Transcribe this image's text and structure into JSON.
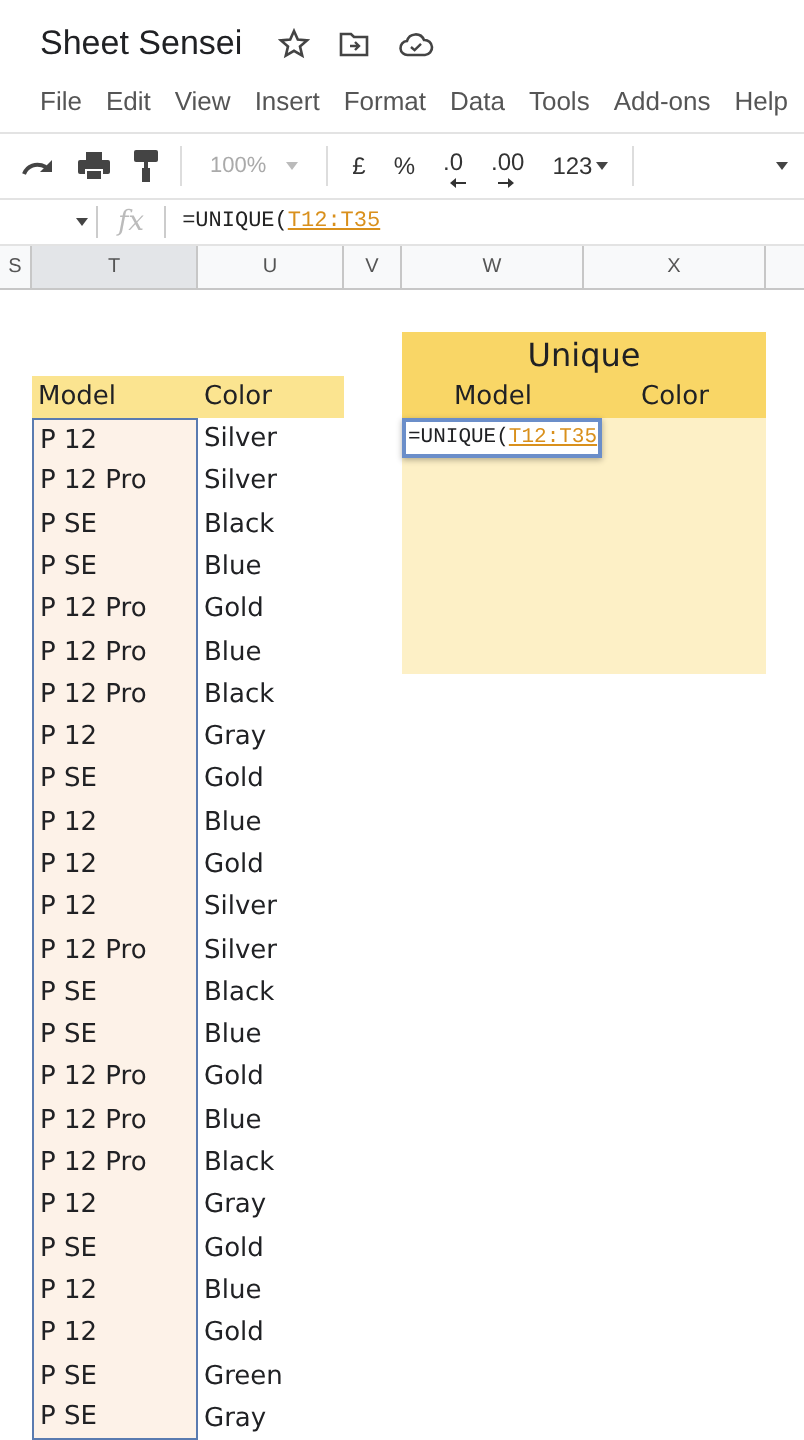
{
  "app": {
    "title": "Sheet Sensei"
  },
  "menu": [
    "File",
    "Edit",
    "View",
    "Insert",
    "Format",
    "Data",
    "Tools",
    "Add-ons",
    "Help"
  ],
  "toolbar": {
    "zoom": "100%",
    "currency": "£",
    "percent": "%",
    "decrease_decimal": ".0",
    "increase_decimal": ".00",
    "number_format": "123"
  },
  "formula_bar": {
    "fx": "fx",
    "formula": "=UNIQUE(",
    "range": "T12:T35"
  },
  "columns": [
    {
      "label": "S",
      "selected": false
    },
    {
      "label": "T",
      "selected": true
    },
    {
      "label": "U",
      "selected": false
    },
    {
      "label": "V",
      "selected": false
    },
    {
      "label": "W",
      "selected": false
    },
    {
      "label": "X",
      "selected": false
    }
  ],
  "source": {
    "headers": [
      "Model",
      "Color"
    ],
    "rows": [
      [
        "P 12",
        "Silver"
      ],
      [
        "P 12 Pro",
        "Silver"
      ],
      [
        "P SE",
        "Black"
      ],
      [
        "P SE",
        "Blue"
      ],
      [
        "P 12 Pro",
        "Gold"
      ],
      [
        "P 12 Pro",
        "Blue"
      ],
      [
        "P 12 Pro",
        "Black"
      ],
      [
        "P 12",
        "Gray"
      ],
      [
        "P SE",
        "Gold"
      ],
      [
        "P 12",
        "Blue"
      ],
      [
        "P 12",
        "Gold"
      ],
      [
        "P 12",
        "Silver"
      ],
      [
        "P 12 Pro",
        "Silver"
      ],
      [
        "P SE",
        "Black"
      ],
      [
        "P SE",
        "Blue"
      ],
      [
        "P 12 Pro",
        "Gold"
      ],
      [
        "P 12 Pro",
        "Blue"
      ],
      [
        "P 12 Pro",
        "Black"
      ],
      [
        "P 12",
        "Gray"
      ],
      [
        "P SE",
        "Gold"
      ],
      [
        "P 12",
        "Blue"
      ],
      [
        "P 12",
        "Gold"
      ],
      [
        "P SE",
        "Green"
      ],
      [
        "P SE",
        "Gray"
      ]
    ]
  },
  "unique": {
    "title": "Unique",
    "headers": [
      "Model",
      "Color"
    ],
    "editor": {
      "formula": "=UNIQUE(",
      "range": "T12:T35"
    }
  }
}
